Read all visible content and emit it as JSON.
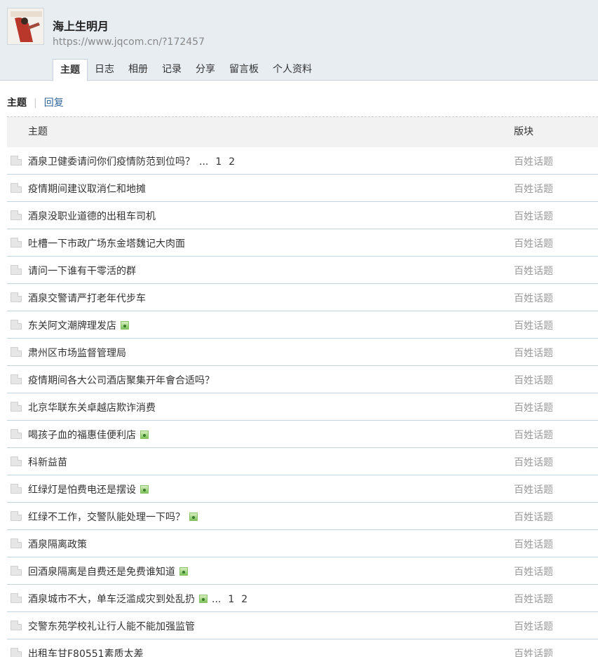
{
  "profile": {
    "username": "海上生明月",
    "url": "https://www.jqcom.cn/?172457"
  },
  "tabs": [
    {
      "label": "主题",
      "active": true
    },
    {
      "label": "日志",
      "active": false
    },
    {
      "label": "相册",
      "active": false
    },
    {
      "label": "记录",
      "active": false
    },
    {
      "label": "分享",
      "active": false
    },
    {
      "label": "留言板",
      "active": false
    },
    {
      "label": "个人资料",
      "active": false
    }
  ],
  "subnav": {
    "current": "主题",
    "separator": "|",
    "reply": "回复"
  },
  "table": {
    "header_subject": "主题",
    "header_forum": "版块",
    "rows": [
      {
        "title": "酒泉卫健委请问你们疫情防范到位吗？",
        "forum": "百姓话题",
        "has_image": false,
        "pages": [
          "1",
          "2"
        ]
      },
      {
        "title": "疫情期间建议取消仁和地摊",
        "forum": "百姓话题",
        "has_image": false,
        "pages": []
      },
      {
        "title": "酒泉没职业道德的出租车司机",
        "forum": "百姓话题",
        "has_image": false,
        "pages": []
      },
      {
        "title": "吐槽一下市政广场东金塔魏记大肉面",
        "forum": "百姓话题",
        "has_image": false,
        "pages": []
      },
      {
        "title": "请问一下谁有干零活的群",
        "forum": "百姓话题",
        "has_image": false,
        "pages": []
      },
      {
        "title": "酒泉交警请严打老年代步车",
        "forum": "百姓话题",
        "has_image": false,
        "pages": []
      },
      {
        "title": "东关阿文潮牌理发店",
        "forum": "百姓话题",
        "has_image": true,
        "pages": []
      },
      {
        "title": "肃州区市场监督管理局",
        "forum": "百姓话题",
        "has_image": false,
        "pages": []
      },
      {
        "title": "疫情期间各大公司酒店聚集开年會合适吗？",
        "forum": "百姓话题",
        "has_image": false,
        "pages": []
      },
      {
        "title": "北京华联东关卓越店欺诈消费",
        "forum": "百姓话题",
        "has_image": false,
        "pages": []
      },
      {
        "title": "喝孩子血的福惠佳便利店",
        "forum": "百姓话题",
        "has_image": true,
        "pages": []
      },
      {
        "title": "科新益苗",
        "forum": "百姓话题",
        "has_image": false,
        "pages": []
      },
      {
        "title": "红绿灯是怕费电还是摆设",
        "forum": "百姓话题",
        "has_image": true,
        "pages": []
      },
      {
        "title": "红绿不工作，交警队能处理一下吗？",
        "forum": "百姓话题",
        "has_image": true,
        "pages": []
      },
      {
        "title": "酒泉隔离政策",
        "forum": "百姓话题",
        "has_image": false,
        "pages": []
      },
      {
        "title": "回酒泉隔离是自费还是免费谁知道",
        "forum": "百姓话题",
        "has_image": true,
        "pages": []
      },
      {
        "title": "酒泉城市不大，单车泛滥成灾到处乱扔",
        "forum": "百姓话题",
        "has_image": true,
        "pages": [
          "1",
          "2"
        ]
      },
      {
        "title": "交警东苑学校礼让行人能不能加强监管",
        "forum": "百姓话题",
        "has_image": false,
        "pages": []
      },
      {
        "title": "出租车甘F80551素质太差",
        "forum": "百姓话题",
        "has_image": false,
        "pages": []
      }
    ]
  },
  "ellipsis": "...",
  "icons": {
    "avatar": "avatar-image",
    "doc": "document-icon",
    "image": "image-attachment-icon"
  },
  "colors": {
    "header_bg": "#e8edf2",
    "row_border": "#c2d5e3",
    "link": "#336699",
    "forum_text": "#999999"
  }
}
